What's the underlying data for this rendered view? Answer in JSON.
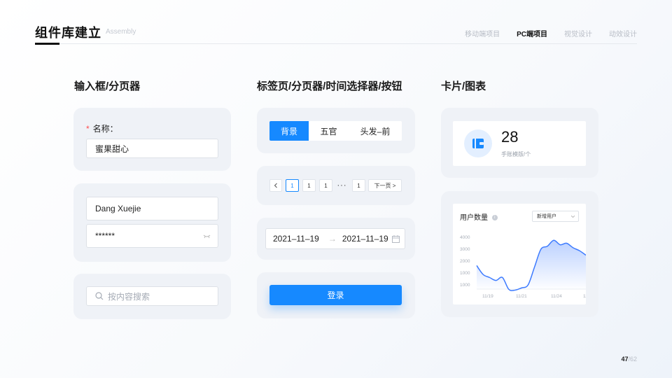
{
  "header": {
    "title": "组件库建立",
    "subtitle": "Assembly",
    "nav": [
      "移动端项目",
      "PC端项目",
      "视觉设计",
      "动效设计"
    ],
    "active_nav": 1
  },
  "sections": {
    "inputs": "输入框/分页器",
    "tabs": "标签页/分页器/时间选择器/按钮",
    "cards": "卡片/图表"
  },
  "form": {
    "name_label": "名称：",
    "name_value": "蜜果甜心",
    "username_value": "Dang Xuejie",
    "password_value": "******",
    "search_placeholder": "按内容搜索"
  },
  "tabs": [
    "背景",
    "五官",
    "头发–前"
  ],
  "pagination": {
    "pages": [
      "1",
      "1",
      "1"
    ],
    "ellipsis": "···",
    "last": "1",
    "next": "下一页 >"
  },
  "date_range": {
    "start": "2021–11–19",
    "arrow": "→",
    "end": "2021–11–19"
  },
  "login_button": "登录",
  "stat": {
    "value": "28",
    "label": "手账模版/个"
  },
  "chart_data": {
    "type": "area",
    "title": "用户数量",
    "select": "新增用户",
    "y_ticks": [
      "4000",
      "3000",
      "2000",
      "1000",
      "1000"
    ],
    "x_ticks": [
      "11/19",
      "11/21",
      "11/24",
      "11/"
    ],
    "x": [
      0,
      1,
      2,
      3,
      4,
      5,
      6,
      7,
      8,
      9,
      10,
      11,
      12,
      13,
      14,
      15,
      16,
      17
    ],
    "values": [
      2300,
      1700,
      1500,
      1300,
      1500,
      700,
      650,
      800,
      1000,
      2200,
      3400,
      3600,
      4000,
      3700,
      3800,
      3500,
      3300,
      3000
    ],
    "ylim": [
      1000,
      4200
    ],
    "color": "#3d7bff"
  },
  "pager": {
    "current": "47",
    "total": "/62"
  }
}
